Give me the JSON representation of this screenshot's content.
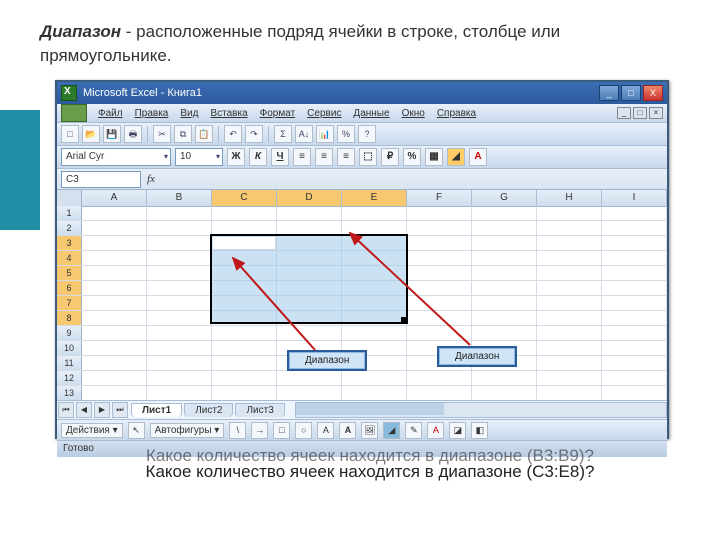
{
  "heading": {
    "term": "Диапазон",
    "rest": " - расположенные подряд ячейки в строке, столбце или прямоугольнике."
  },
  "window": {
    "title": "Microsoft Excel - Книга1",
    "btn_min": "_",
    "btn_max": "□",
    "btn_close": "X"
  },
  "menu": {
    "file": "Файл",
    "edit": "Правка",
    "view": "Вид",
    "insert": "Вставка",
    "format": "Формат",
    "tools": "Сервис",
    "data": "Данные",
    "window": "Окно",
    "help": "Справка"
  },
  "format": {
    "font": "Arial Cyr",
    "size": "10",
    "bold": "Ж",
    "italic": "К",
    "underline": "Ч"
  },
  "cellref": {
    "name": "C3",
    "fx": "fx"
  },
  "cols": [
    "A",
    "B",
    "C",
    "D",
    "E",
    "F",
    "G",
    "H",
    "I"
  ],
  "rows": [
    "1",
    "2",
    "3",
    "4",
    "5",
    "6",
    "7",
    "8",
    "9",
    "10",
    "11",
    "12",
    "13"
  ],
  "tabs": {
    "s1": "Лист1",
    "s2": "Лист2",
    "s3": "Лист3"
  },
  "drawbar": {
    "actions": "Действия",
    "autoshapes": "Автофигуры"
  },
  "status": "Готово",
  "callouts": {
    "left": "Диапазон",
    "right": "Диапазон"
  },
  "questions": {
    "q1": "Какое количество ячеек находится в диапазоне (B3:B9)?",
    "q2": "Какое количество ячеек находится в диапазоне (C3:E8)?"
  }
}
